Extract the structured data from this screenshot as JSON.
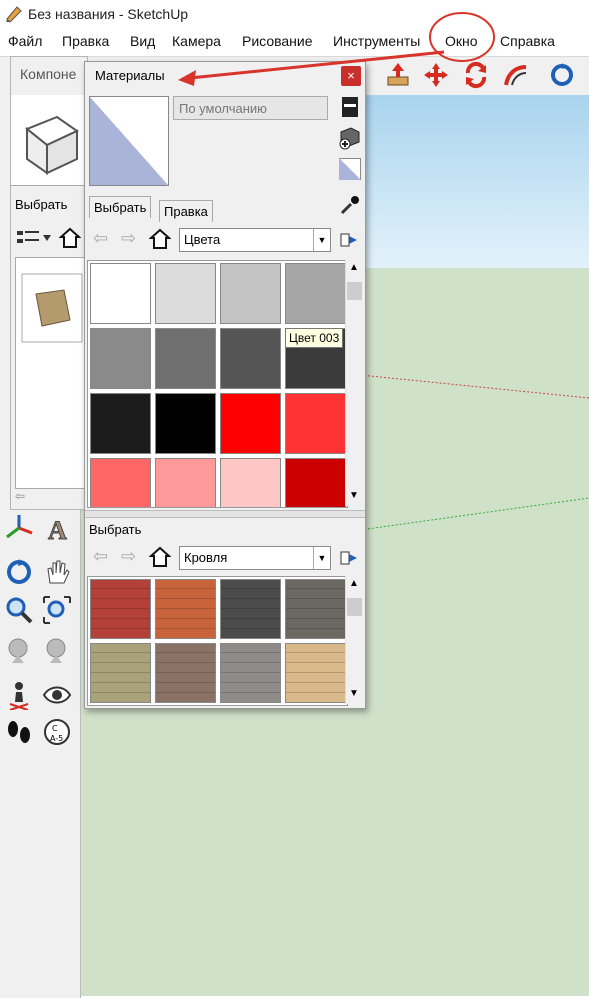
{
  "window": {
    "title": "Без названия - SketchUp"
  },
  "menu": [
    "Файл",
    "Правка",
    "Вид",
    "Камера",
    "Рисование",
    "Инструменты",
    "Окно",
    "Справка"
  ],
  "components_panel": {
    "title": "Компоне",
    "tab_select": "Выбрать"
  },
  "materials": {
    "title": "Материалы",
    "close": "×",
    "default_name": "По умолчанию",
    "tabs": [
      "Выбрать",
      "Правка"
    ],
    "colors_combo": "Цвета",
    "tooltip": "Цвет 003",
    "section2_label": "Выбрать",
    "roof_combo": "Кровля",
    "swatch_colors": [
      "#ffffff",
      "#dcdcdc",
      "#c4c4c4",
      "#a5a5a5",
      "#8a8a8a",
      "#6f6f6f",
      "#555555",
      "#3b3b3b",
      "#1c1c1c",
      "#000000",
      "#ff0000",
      "#ff3333",
      "#ff6666",
      "#ff9999",
      "#ffc6c6",
      "#cc0000"
    ],
    "texture_colors": [
      "#b4403a",
      "#c7643c",
      "#4c4c4c",
      "#6b6862",
      "#a9a27a",
      "#8a7366",
      "#8f8b88",
      "#d9b98a"
    ]
  },
  "colors": {
    "annotation": "#d9342b"
  }
}
